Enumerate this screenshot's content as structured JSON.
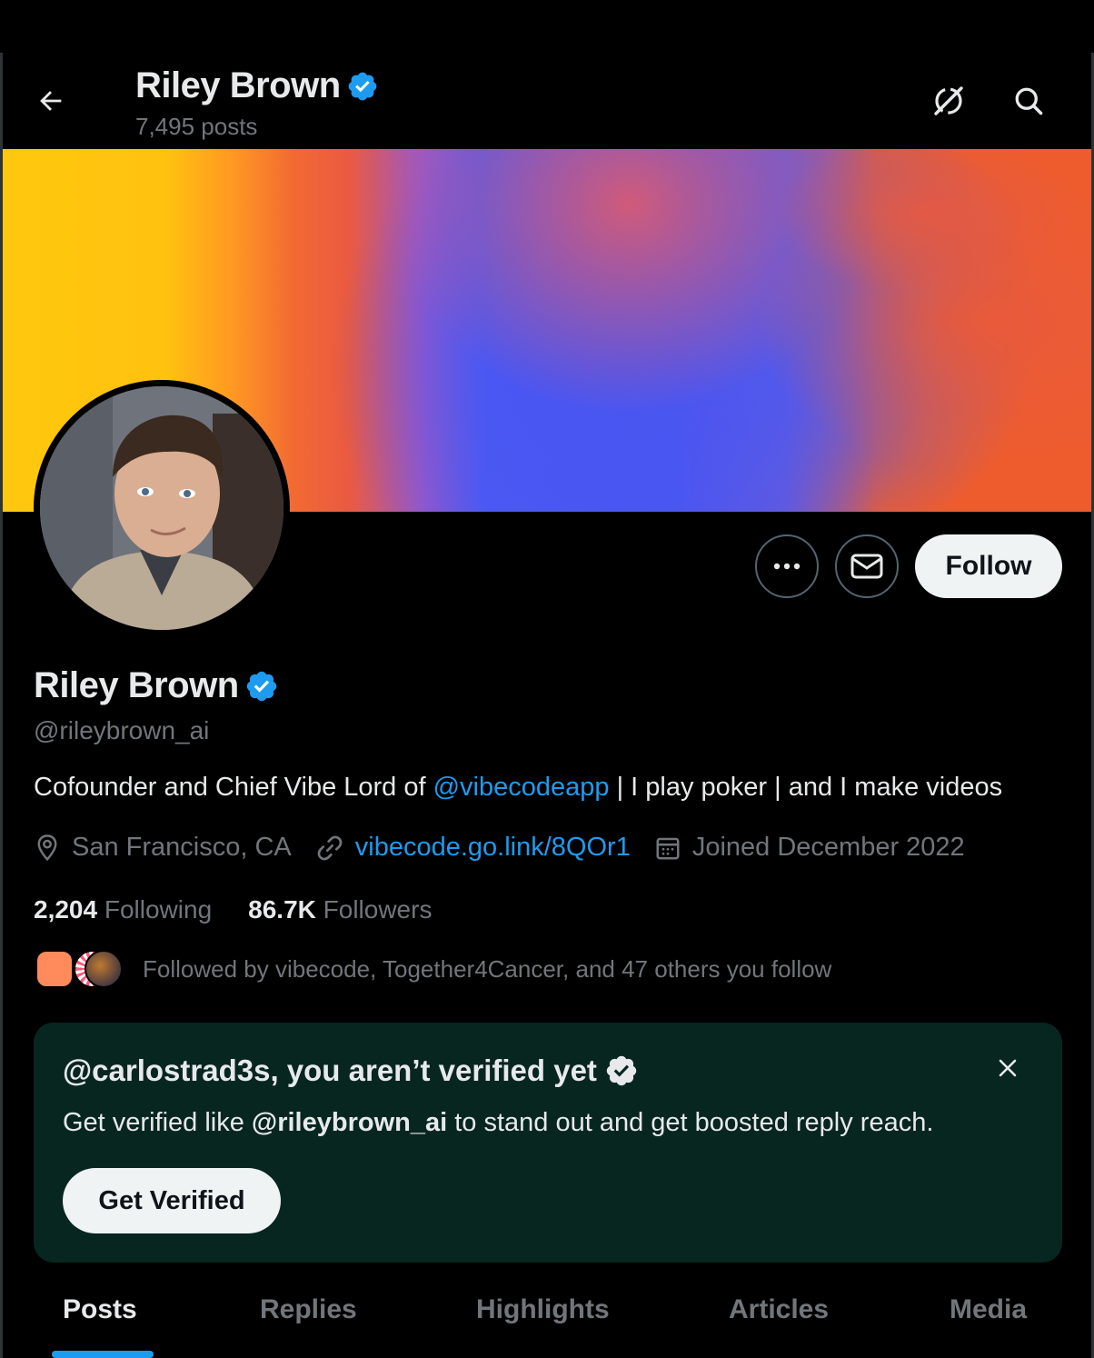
{
  "header": {
    "name": "Riley Brown",
    "posts_count": "7,495 posts",
    "back_icon": "arrow-left-icon",
    "grok_icon": "grok-icon",
    "search_icon": "search-icon"
  },
  "profile": {
    "name": "Riley Brown",
    "handle": "@rileybrown_ai",
    "bio_prefix": "Cofounder and Chief Vibe Lord of ",
    "bio_mention": "@vibecodeapp",
    "bio_suffix": " | I play poker | and I make videos",
    "location": "San Francisco, CA",
    "website": "vibecode.go.link/8QOr1",
    "joined": "Joined December 2022",
    "following_count": "2,204",
    "following_label": "Following",
    "followers_count": "86.7K",
    "followers_label": "Followers",
    "followed_by": "Followed by vibecode, Together4Cancer, and 47 others you follow",
    "verified_color": "#1d9bf0"
  },
  "actions": {
    "more_icon": "more-icon",
    "message_icon": "envelope-icon",
    "follow_label": "Follow"
  },
  "verify_card": {
    "title": "@carlostrad3s, you aren’t verified yet",
    "text_prefix": "Get verified like ",
    "text_handle": "@rileybrown_ai",
    "text_suffix": " to stand out and get boosted reply reach.",
    "button_label": "Get Verified",
    "close_icon": "close-icon",
    "background": "#07261f"
  },
  "tabs": [
    {
      "label": "Posts",
      "active": true
    },
    {
      "label": "Replies",
      "active": false
    },
    {
      "label": "Highlights",
      "active": false
    },
    {
      "label": "Articles",
      "active": false
    },
    {
      "label": "Media",
      "active": false
    }
  ],
  "colors": {
    "accent": "#1d9bf0",
    "background": "#000000",
    "secondary_text": "#71767b"
  }
}
